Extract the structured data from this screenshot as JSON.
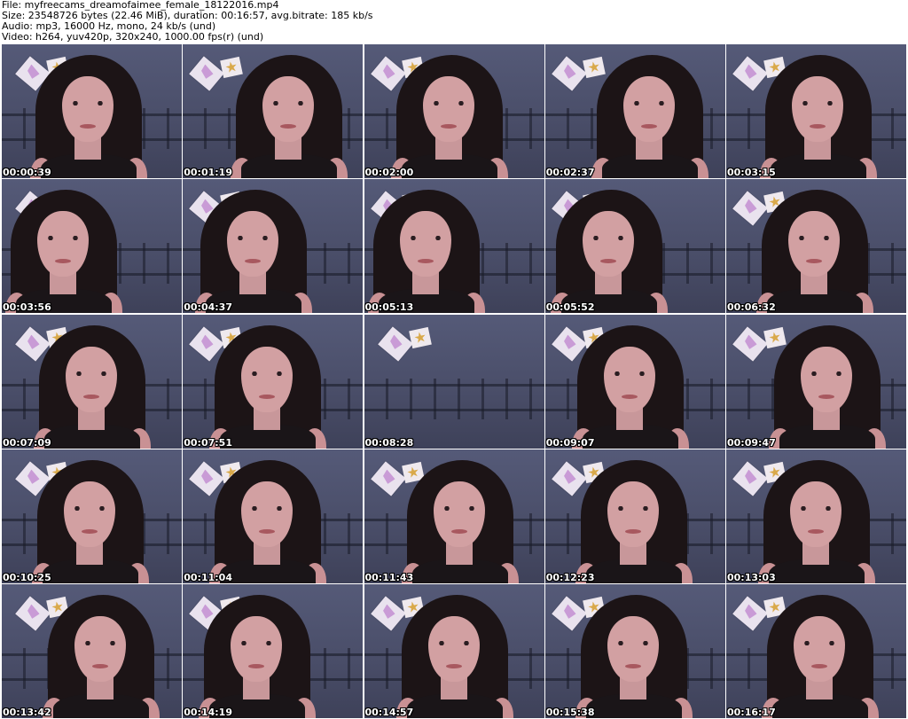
{
  "header": {
    "file_line": "File: myfreecams_dreamofaimee_female_18122016.mp4",
    "size_line": "Size: 23548726 bytes (22.46 MiB), duration: 00:16:57, avg.bitrate: 185 kb/s",
    "audio_line": "Audio: mp3, 16000 Hz, mono, 24 kb/s (und)",
    "video_line": "Video: h264, yuv420p, 320x240, 1000.00 fps(r) (und)"
  },
  "thumbnails": [
    {
      "timestamp": "00:00:39"
    },
    {
      "timestamp": "00:01:19"
    },
    {
      "timestamp": "00:02:00"
    },
    {
      "timestamp": "00:02:37"
    },
    {
      "timestamp": "00:03:15"
    },
    {
      "timestamp": "00:03:56"
    },
    {
      "timestamp": "00:04:37"
    },
    {
      "timestamp": "00:05:13"
    },
    {
      "timestamp": "00:05:52"
    },
    {
      "timestamp": "00:06:32"
    },
    {
      "timestamp": "00:07:09"
    },
    {
      "timestamp": "00:07:51"
    },
    {
      "timestamp": "00:08:28"
    },
    {
      "timestamp": "00:09:07"
    },
    {
      "timestamp": "00:09:47"
    },
    {
      "timestamp": "00:10:25"
    },
    {
      "timestamp": "00:11:04"
    },
    {
      "timestamp": "00:11:43"
    },
    {
      "timestamp": "00:12:23"
    },
    {
      "timestamp": "00:13:03"
    },
    {
      "timestamp": "00:13:42"
    },
    {
      "timestamp": "00:14:19"
    },
    {
      "timestamp": "00:14:57"
    },
    {
      "timestamp": "00:15:38"
    },
    {
      "timestamp": "00:16:17"
    }
  ],
  "colors": {
    "page_background": "#ffffff",
    "header_text": "#000000",
    "timestamp_text": "#ffffff",
    "wall": "#4a4e69",
    "hair": "#1c1416",
    "skin": "#d2a0a2"
  },
  "icons": {
    "wall_decor_left": "diamond-card-icon",
    "wall_decor_right": "star-icon"
  }
}
